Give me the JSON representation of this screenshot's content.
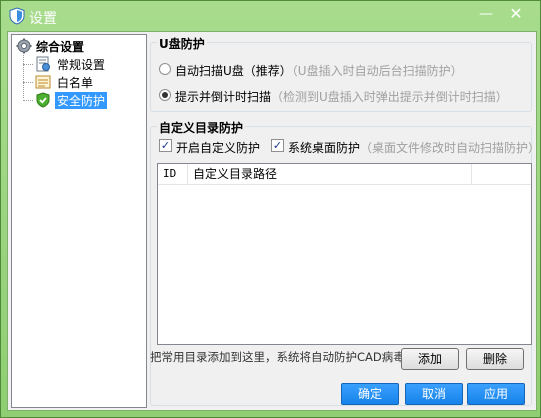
{
  "window": {
    "title": "设置",
    "minimize_label": "—",
    "close_label": "✕"
  },
  "tree": {
    "root_label": "综合设置",
    "items": [
      {
        "label": "常规设置",
        "icon": "settings-doc-icon"
      },
      {
        "label": "白名单",
        "icon": "whitelist-icon"
      },
      {
        "label": "安全防护",
        "icon": "shield-check-icon",
        "selected": true
      }
    ]
  },
  "usb": {
    "title": "U盘防护",
    "options": [
      {
        "label": "自动扫描U盘（推荐）",
        "hint": "（U盘插入时自动后台扫描防护）",
        "selected": false
      },
      {
        "label": "提示并倒计时扫描",
        "hint": "（检测到U盘插入时弹出提示并倒计时扫描）",
        "selected": true
      }
    ]
  },
  "custom": {
    "title": "自定义目录防护",
    "enable_label": "开启自定义防护",
    "enable_checked": true,
    "desktop_label": "系统桌面防护",
    "desktop_checked": true,
    "desktop_hint": "（桌面文件修改时自动扫描防护）",
    "columns": {
      "id": "ID",
      "path": "自定义目录路径"
    },
    "rows": [],
    "note": "把常用目录添加到这里，系统将自动防护CAD病毒！",
    "add_label": "添加",
    "delete_label": "删除"
  },
  "footer": {
    "ok_label": "确定",
    "cancel_label": "取消",
    "apply_label": "应用"
  },
  "colors": {
    "frame": "#98d57e",
    "selection": "#3399ff",
    "primary_button": "#1e88f0",
    "hint_text": "#a0a0a0"
  }
}
